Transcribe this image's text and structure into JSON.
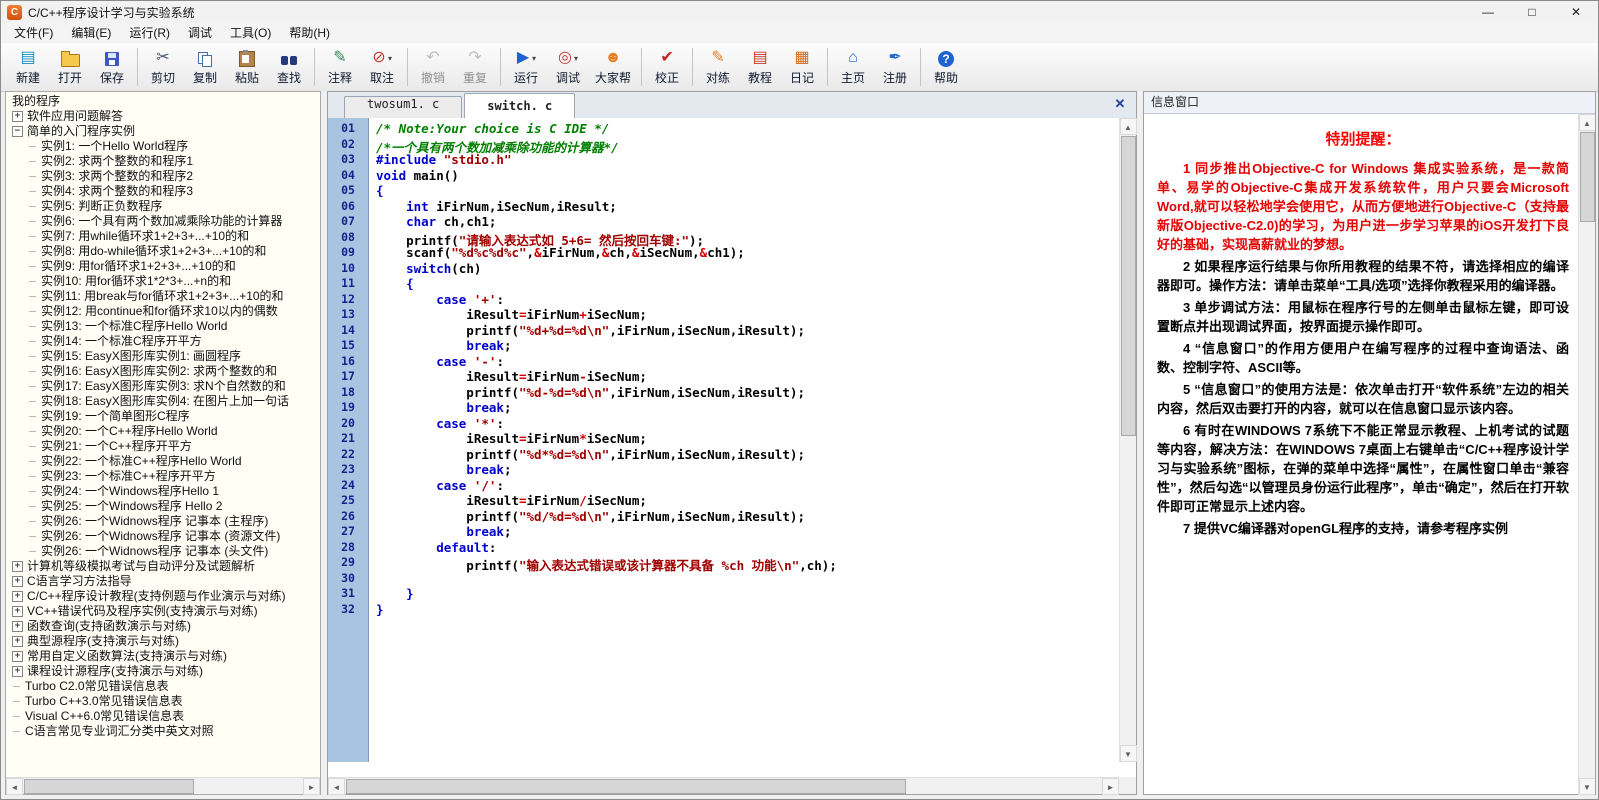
{
  "window": {
    "title": "C/C++程序设计学习与实验系统",
    "app_icon_letter": "C",
    "controls": {
      "minimize": "—",
      "maximize": "□",
      "close": "✕"
    }
  },
  "menu": {
    "items": [
      "文件(F)",
      "编辑(E)",
      "运行(R)",
      "调试",
      "工具(O)",
      "帮助(H)"
    ]
  },
  "toolbar": {
    "buttons": [
      {
        "name": "new-button",
        "icon": "new-file-icon",
        "label": "新建",
        "glyph": "▤",
        "color": "#1b8ebf"
      },
      {
        "name": "open-button",
        "icon": "open-folder-icon",
        "label": "打开"
      },
      {
        "name": "save-button",
        "icon": "save-floppy-icon",
        "label": "保存",
        "sep_after": true
      },
      {
        "name": "cut-button",
        "icon": "cut-scissors-icon",
        "label": "剪切",
        "glyph": "✂",
        "color": "#40566e"
      },
      {
        "name": "copy-button",
        "icon": "copy-icon",
        "label": "复制"
      },
      {
        "name": "paste-button",
        "icon": "paste-clipboard-icon",
        "label": "粘贴"
      },
      {
        "name": "find-button",
        "icon": "find-binoculars-icon",
        "label": "查找",
        "sep_after": true
      },
      {
        "name": "comment-button",
        "icon": "comment-icon",
        "label": "注释",
        "glyph": "✎",
        "color": "#2e8b57"
      },
      {
        "name": "uncomment-button",
        "icon": "uncomment-icon",
        "label": "取注",
        "glyph": "⊘",
        "color": "#c0392b",
        "arrow": true,
        "sep_after": true
      },
      {
        "name": "undo-button",
        "icon": "undo-arrow-icon",
        "label": "撤销",
        "glyph": "↶",
        "color": "#7a7a7a",
        "disabled": true
      },
      {
        "name": "redo-button",
        "icon": "redo-arrow-icon",
        "label": "重复",
        "glyph": "↷",
        "color": "#7a7a7a",
        "disabled": true,
        "sep_after": true
      },
      {
        "name": "run-button",
        "icon": "run-play-icon",
        "label": "运行",
        "glyph": "▶",
        "color": "#1f63d0",
        "arrow": true
      },
      {
        "name": "debug-button",
        "icon": "debug-icon",
        "label": "调试",
        "glyph": "◎",
        "color": "#c0392b",
        "arrow": true
      },
      {
        "name": "community-help-button",
        "icon": "community-people-icon",
        "label": "大家帮",
        "glyph": "☻",
        "color": "#e67e22",
        "sep_after": true
      },
      {
        "name": "correct-button",
        "icon": "check-icon",
        "label": "校正",
        "glyph": "✔",
        "color": "#d02020",
        "sep_after": true
      },
      {
        "name": "practice-button",
        "icon": "practice-pencil-icon",
        "label": "对练",
        "glyph": "✎",
        "color": "#e67e22"
      },
      {
        "name": "tutorial-button",
        "icon": "tutorial-book-icon",
        "label": "教程",
        "glyph": "▤",
        "color": "#c0392b"
      },
      {
        "name": "diary-button",
        "icon": "diary-calendar-icon",
        "label": "日记",
        "glyph": "▦",
        "color": "#d2691e",
        "sep_after": true
      },
      {
        "name": "home-button",
        "icon": "home-icon",
        "label": "主页",
        "glyph": "⌂",
        "color": "#1f63d0"
      },
      {
        "name": "register-button",
        "icon": "register-pen-icon",
        "label": "注册",
        "glyph": "✒",
        "color": "#1f63d0",
        "sep_after": true
      },
      {
        "name": "help-button",
        "icon": "help-question-icon",
        "label": "帮助",
        "glyph": "?"
      }
    ]
  },
  "sidebar": {
    "items": [
      {
        "label": "我的程序",
        "level": 0,
        "toggle": "none"
      },
      {
        "label": "软件应用问题解答",
        "level": 0,
        "toggle": "plus"
      },
      {
        "label": "简单的入门程序实例",
        "level": 0,
        "toggle": "minus"
      },
      {
        "label": "实例1: 一个Hello World程序",
        "level": 1,
        "toggle": "leaf"
      },
      {
        "label": "实例2: 求两个整数的和程序1",
        "level": 1,
        "toggle": "leaf"
      },
      {
        "label": "实例3: 求两个整数的和程序2",
        "level": 1,
        "toggle": "leaf"
      },
      {
        "label": "实例4: 求两个整数的和程序3",
        "level": 1,
        "toggle": "leaf"
      },
      {
        "label": "实例5: 判断正负数程序",
        "level": 1,
        "toggle": "leaf"
      },
      {
        "label": "实例6: 一个具有两个数加减乘除功能的计算器",
        "level": 1,
        "toggle": "leaf"
      },
      {
        "label": "实例7: 用while循环求1+2+3+...+10的和",
        "level": 1,
        "toggle": "leaf"
      },
      {
        "label": "实例8: 用do-while循环求1+2+3+...+10的和",
        "level": 1,
        "toggle": "leaf"
      },
      {
        "label": "实例9: 用for循环求1+2+3+...+10的和",
        "level": 1,
        "toggle": "leaf"
      },
      {
        "label": "实例10: 用for循环求1*2*3+...+n的和",
        "level": 1,
        "toggle": "leaf"
      },
      {
        "label": "实例11: 用break与for循环求1+2+3+...+10的和",
        "level": 1,
        "toggle": "leaf"
      },
      {
        "label": "实例12: 用continue和for循环求10以内的偶数",
        "level": 1,
        "toggle": "leaf"
      },
      {
        "label": "实例13: 一个标准C程序Hello World",
        "level": 1,
        "toggle": "leaf"
      },
      {
        "label": "实例14: 一个标准C程序开平方",
        "level": 1,
        "toggle": "leaf"
      },
      {
        "label": "实例15: EasyX图形库实例1: 画圆程序",
        "level": 1,
        "toggle": "leaf"
      },
      {
        "label": "实例16: EasyX图形库实例2: 求两个整数的和",
        "level": 1,
        "toggle": "leaf"
      },
      {
        "label": "实例17: EasyX图形库实例3: 求N个自然数的和",
        "level": 1,
        "toggle": "leaf"
      },
      {
        "label": "实例18: EasyX图形库实例4: 在图片上加一句话",
        "level": 1,
        "toggle": "leaf"
      },
      {
        "label": "实例19: 一个简单图形C程序",
        "level": 1,
        "toggle": "leaf"
      },
      {
        "label": "实例20: 一个C++程序Hello World",
        "level": 1,
        "toggle": "leaf"
      },
      {
        "label": "实例21: 一个C++程序开平方",
        "level": 1,
        "toggle": "leaf"
      },
      {
        "label": "实例22: 一个标准C++程序Hello World",
        "level": 1,
        "toggle": "leaf"
      },
      {
        "label": "实例23: 一个标准C++程序开平方",
        "level": 1,
        "toggle": "leaf"
      },
      {
        "label": "实例24: 一个Windows程序Hello 1",
        "level": 1,
        "toggle": "leaf"
      },
      {
        "label": "实例25: 一个Windows程序 Hello 2",
        "level": 1,
        "toggle": "leaf"
      },
      {
        "label": "实例26: 一个Widnows程序 记事本 (主程序)",
        "level": 1,
        "toggle": "leaf"
      },
      {
        "label": "实例26: 一个Widnows程序 记事本 (资源文件)",
        "level": 1,
        "toggle": "leaf"
      },
      {
        "label": "实例26: 一个Widnows程序 记事本 (头文件)",
        "level": 1,
        "toggle": "leaf"
      },
      {
        "label": "计算机等级模拟考试与自动评分及试题解析",
        "level": 0,
        "toggle": "plus"
      },
      {
        "label": "C语言学习方法指导",
        "level": 0,
        "toggle": "plus"
      },
      {
        "label": "C/C++程序设计教程(支持例题与作业演示与对练)",
        "level": 0,
        "toggle": "plus"
      },
      {
        "label": "VC++错误代码及程序实例(支持演示与对练)",
        "level": 0,
        "toggle": "plus"
      },
      {
        "label": "函数查询(支持函数演示与对练)",
        "level": 0,
        "toggle": "plus"
      },
      {
        "label": "典型源程序(支持演示与对练)",
        "level": 0,
        "toggle": "plus"
      },
      {
        "label": "常用自定义函数算法(支持演示与对练)",
        "level": 0,
        "toggle": "plus"
      },
      {
        "label": "课程设计源程序(支持演示与对练)",
        "level": 0,
        "toggle": "plus"
      },
      {
        "label": "Turbo C2.0常见错误信息表",
        "level": 0,
        "toggle": "dash"
      },
      {
        "label": "Turbo C++3.0常见错误信息表",
        "level": 0,
        "toggle": "dash"
      },
      {
        "label": "Visual C++6.0常见错误信息表",
        "level": 0,
        "toggle": "dash"
      },
      {
        "label": "C语言常见专业词汇分类中英文对照",
        "level": 0,
        "toggle": "dash"
      }
    ]
  },
  "editor": {
    "tabs": [
      {
        "label": "twosum1. c",
        "active": false
      },
      {
        "label": "switch. c",
        "active": true
      }
    ],
    "lines": [
      "/* Note:Your choice is C IDE */",
      "/*一个具有两个数加减乘除功能的计算器*/",
      "#include \"stdio.h\"",
      "void main()",
      "{",
      "    int iFirNum,iSecNum,iResult;",
      "    char ch,ch1;",
      "    printf(\"请输入表达式如 5+6= 然后按回车键:\");",
      "    scanf(\"%d%c%d%c\",&iFirNum,&ch,&iSecNum,&ch1);",
      "    switch(ch)",
      "    {",
      "        case '+':",
      "            iResult=iFirNum+iSecNum;",
      "            printf(\"%d+%d=%d\\n\",iFirNum,iSecNum,iResult);",
      "            break;",
      "        case '-':",
      "            iResult=iFirNum-iSecNum;",
      "            printf(\"%d-%d=%d\\n\",iFirNum,iSecNum,iResult);",
      "            break;",
      "        case '*':",
      "            iResult=iFirNum*iSecNum;",
      "            printf(\"%d*%d=%d\\n\",iFirNum,iSecNum,iResult);",
      "            break;",
      "        case '/':",
      "            iResult=iFirNum/iSecNum;",
      "            printf(\"%d/%d=%d\\n\",iFirNum,iSecNum,iResult);",
      "            break;",
      "        default:",
      "            printf(\"输入表达式错误或该计算器不具备 %ch 功能\\n\",ch);",
      "",
      "    }",
      "}"
    ]
  },
  "info": {
    "title": "信息窗口",
    "heading": "特别提醒：",
    "paragraphs": [
      {
        "red": true,
        "text": "1 同步推出Objective-C for Windows 集成实验系统，是一款简单、易学的Objective-C集成开发系统软件，用户只要会Microsoft Word,就可以轻松地学会使用它，从而方便地进行Objective-C（支持最新版Objective-C2.0)的学习，为用户进一步学习苹果的iOS开发打下良好的基础，实现高薪就业的梦想。"
      },
      {
        "red": false,
        "text": "2 如果程序运行结果与你所用教程的结果不符，请选择相应的编译器即可。操作方法：请单击菜单“工具/选项”选择你教程采用的编译器。"
      },
      {
        "red": false,
        "text": "3 单步调试方法：用鼠标在程序行号的左侧单击鼠标左键，即可设置断点并出现调试界面，按界面提示操作即可。"
      },
      {
        "red": false,
        "text": "4 “信息窗口”的作用方便用户在编写程序的过程中查询语法、函数、控制字符、ASCII等。"
      },
      {
        "red": false,
        "text": "5 “信息窗口”的使用方法是：依次单击打开“软件系统”左边的相关内容，然后双击要打开的内容，就可以在信息窗口显示该内容。"
      },
      {
        "red": false,
        "text": "6 有时在WINDOWS 7系统下不能正常显示教程、上机考试的试题等内容，解决方法：在WINDOWS 7桌面上右键单击“C/C++程序设计学习与实验系统”图标，在弹的菜单中选择“属性”，在属性窗口单击“兼容性”，然后勾选“以管理员身份运行此程序”，单击“确定”，然后在打开软件即可正常显示上述内容。"
      },
      {
        "red": false,
        "text": "7 提供VC编译器对openGL程序的支持，请参考程序实例"
      }
    ]
  }
}
